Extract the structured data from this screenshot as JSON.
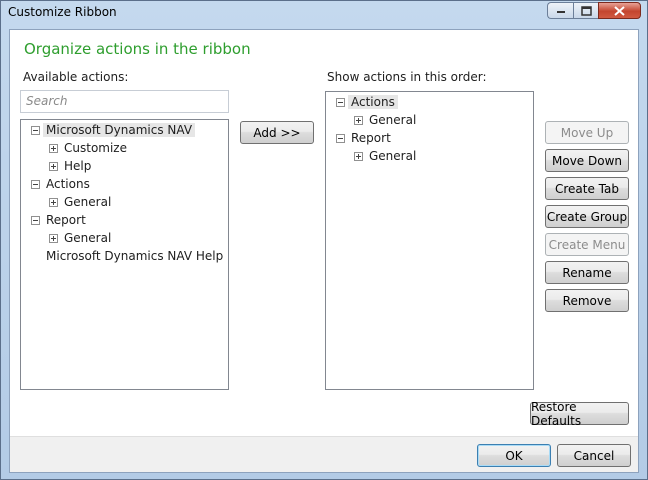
{
  "window": {
    "title": "Customize Ribbon"
  },
  "heading": "Organize actions in the ribbon",
  "available": {
    "label": "Available actions:",
    "search_placeholder": "Search",
    "items": [
      {
        "label": "Microsoft Dynamics NAV",
        "expander": "minus",
        "level": 0,
        "selected": true
      },
      {
        "label": "Customize",
        "expander": "plus",
        "level": 1
      },
      {
        "label": "Help",
        "expander": "plus",
        "level": 1
      },
      {
        "label": "Actions",
        "expander": "minus",
        "level": 0
      },
      {
        "label": "General",
        "expander": "plus",
        "level": 1
      },
      {
        "label": "Report",
        "expander": "minus",
        "level": 0
      },
      {
        "label": "General",
        "expander": "plus",
        "level": 1
      },
      {
        "label": "Microsoft Dynamics NAV Help",
        "expander": "none",
        "level": 0
      }
    ]
  },
  "add_button": "Add >>",
  "order": {
    "label": "Show actions in this order:",
    "items": [
      {
        "label": "Actions",
        "expander": "minus",
        "level": 0,
        "selected": true
      },
      {
        "label": "General",
        "expander": "plus",
        "level": 1
      },
      {
        "label": "Report",
        "expander": "minus",
        "level": 0
      },
      {
        "label": "General",
        "expander": "plus",
        "level": 1
      }
    ]
  },
  "side_buttons": {
    "move_up": "Move Up",
    "move_down": "Move Down",
    "create_tab": "Create Tab",
    "create_group": "Create Group",
    "create_menu": "Create Menu",
    "rename": "Rename",
    "remove": "Remove"
  },
  "restore_defaults": "Restore Defaults",
  "footer": {
    "ok": "OK",
    "cancel": "Cancel"
  },
  "colors": {
    "heading": "#2e9e2e",
    "disabled_text": "#8c8c8c"
  }
}
